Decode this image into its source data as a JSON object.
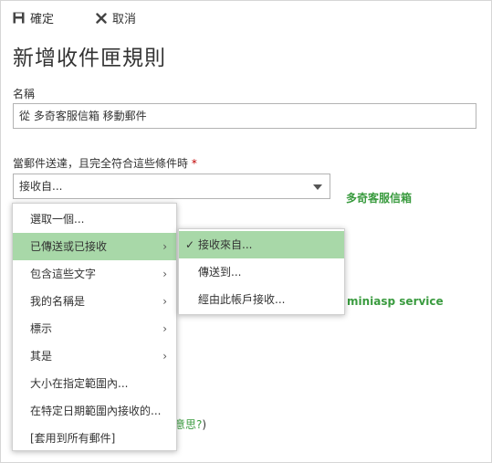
{
  "toolbar": {
    "save_label": "確定",
    "cancel_label": "取消"
  },
  "page_title": "新增收件匣規則",
  "name_field": {
    "label": "名稱",
    "value": "從 多奇客服信箱 移動郵件"
  },
  "condition": {
    "label": "當郵件送達，且完全符合這些條件時",
    "required_mark": "*",
    "selected": "接收自..."
  },
  "side_links": {
    "mailbox": "多奇客服信箱",
    "service": "miniasp service"
  },
  "tail": {
    "text_link": "意思?",
    "text_paren": ")"
  },
  "main_menu": {
    "items": [
      {
        "label": "選取一個...",
        "has_submenu": false,
        "selected": false
      },
      {
        "label": "已傳送或已接收",
        "has_submenu": true,
        "selected": true
      },
      {
        "label": "包含這些文字",
        "has_submenu": true,
        "selected": false
      },
      {
        "label": "我的名稱是",
        "has_submenu": true,
        "selected": false
      },
      {
        "label": "標示",
        "has_submenu": true,
        "selected": false
      },
      {
        "label": "其是",
        "has_submenu": true,
        "selected": false
      },
      {
        "label": "大小在指定範圍內...",
        "has_submenu": false,
        "selected": false
      },
      {
        "label": "在特定日期範圍內接收的...",
        "has_submenu": false,
        "selected": false
      },
      {
        "label": "[套用到所有郵件]",
        "has_submenu": false,
        "selected": false
      }
    ]
  },
  "sub_menu": {
    "items": [
      {
        "label": "接收來自...",
        "checked": true
      },
      {
        "label": "傳送到...",
        "checked": false
      },
      {
        "label": "經由此帳戶接收...",
        "checked": false
      }
    ]
  },
  "colors": {
    "accent_green": "#3a9b3f",
    "highlight": "#a8d8a8",
    "required": "#c00000"
  },
  "icons": {
    "save": "save-icon",
    "cancel": "close-icon",
    "chevron": "chevron-right-icon",
    "check": "check-icon",
    "dropdown": "caret-down-icon"
  }
}
